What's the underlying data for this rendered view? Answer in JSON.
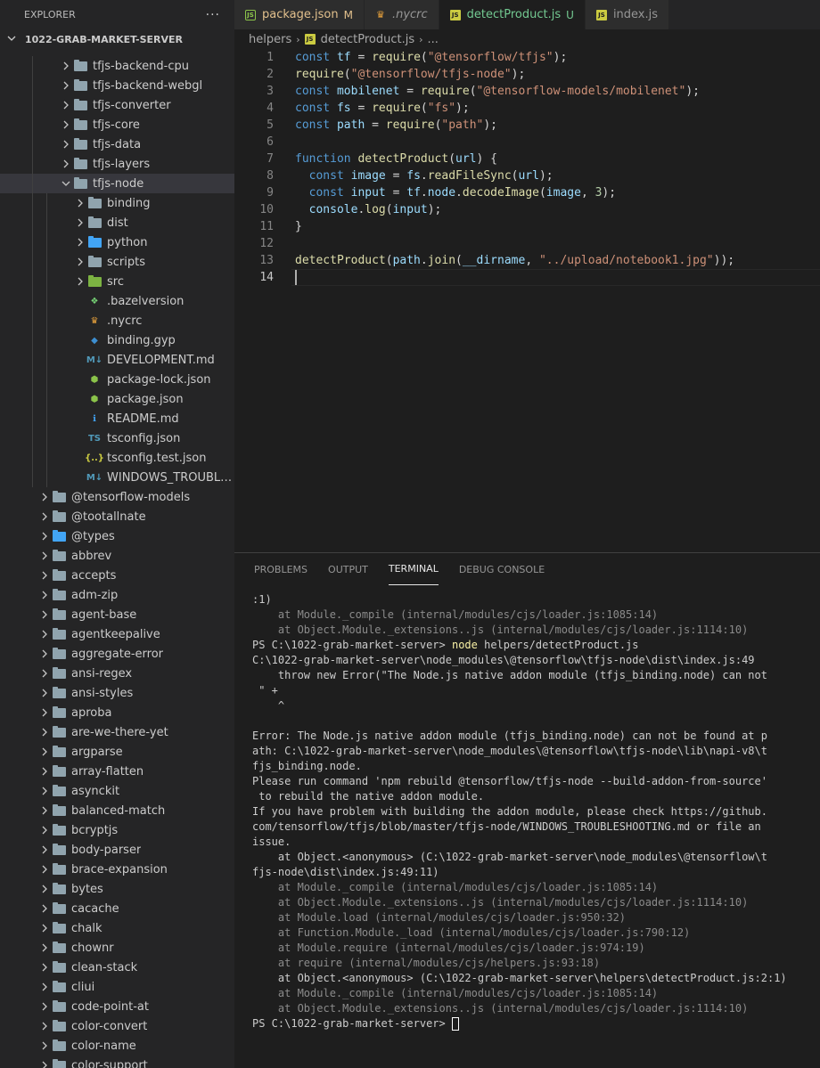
{
  "sidebar": {
    "title": "EXPLORER",
    "more_label": "···",
    "project": "1022-GRAB-MARKET-SERVER",
    "items": [
      {
        "label": "tfjs-backend-cpu",
        "kind": "folder",
        "expanded": false,
        "depth": 2,
        "color": "gray",
        "icon": "folder-icon"
      },
      {
        "label": "tfjs-backend-webgl",
        "kind": "folder",
        "expanded": false,
        "depth": 2,
        "color": "gray",
        "icon": "folder-icon"
      },
      {
        "label": "tfjs-converter",
        "kind": "folder",
        "expanded": false,
        "depth": 2,
        "color": "gray",
        "icon": "folder-icon"
      },
      {
        "label": "tfjs-core",
        "kind": "folder",
        "expanded": false,
        "depth": 2,
        "color": "gray",
        "icon": "folder-icon"
      },
      {
        "label": "tfjs-data",
        "kind": "folder",
        "expanded": false,
        "depth": 2,
        "color": "gray",
        "icon": "folder-icon"
      },
      {
        "label": "tfjs-layers",
        "kind": "folder",
        "expanded": false,
        "depth": 2,
        "color": "gray",
        "icon": "folder-icon"
      },
      {
        "label": "tfjs-node",
        "kind": "folder",
        "expanded": true,
        "depth": 2,
        "color": "gray",
        "icon": "folder-open-icon",
        "selected": true
      },
      {
        "label": "binding",
        "kind": "folder",
        "expanded": false,
        "depth": 3,
        "color": "gray",
        "icon": "folder-icon"
      },
      {
        "label": "dist",
        "kind": "folder",
        "expanded": false,
        "depth": 3,
        "color": "gray",
        "icon": "folder-icon"
      },
      {
        "label": "python",
        "kind": "folder",
        "expanded": false,
        "depth": 3,
        "color": "blue",
        "icon": "python-folder-icon"
      },
      {
        "label": "scripts",
        "kind": "folder",
        "expanded": false,
        "depth": 3,
        "color": "gray",
        "icon": "scripts-folder-icon"
      },
      {
        "label": "src",
        "kind": "folder",
        "expanded": false,
        "depth": 3,
        "color": "green",
        "icon": "src-folder-icon"
      },
      {
        "label": ".bazelversion",
        "kind": "file",
        "depth": 3,
        "icon": "bazel-icon",
        "glyph": "❖",
        "gcolor": "#76d275"
      },
      {
        "label": ".nycrc",
        "kind": "file",
        "depth": 3,
        "icon": "nyc-icon",
        "glyph": "♛",
        "gcolor": "#e8a23c"
      },
      {
        "label": "binding.gyp",
        "kind": "file",
        "depth": 3,
        "icon": "python-icon",
        "glyph": "◆",
        "gcolor": "#3d8fd1"
      },
      {
        "label": "DEVELOPMENT.md",
        "kind": "file",
        "depth": 3,
        "icon": "markdown-icon",
        "glyph": "M↓",
        "gcolor": "#519aba"
      },
      {
        "label": "package-lock.json",
        "kind": "file",
        "depth": 3,
        "icon": "nodejs-icon",
        "glyph": "⬢",
        "gcolor": "#8bc34a"
      },
      {
        "label": "package.json",
        "kind": "file",
        "depth": 3,
        "icon": "nodejs-icon",
        "glyph": "⬢",
        "gcolor": "#8bc34a"
      },
      {
        "label": "README.md",
        "kind": "file",
        "depth": 3,
        "icon": "info-icon",
        "glyph": "ℹ",
        "gcolor": "#42a5f5"
      },
      {
        "label": "tsconfig.json",
        "kind": "file",
        "depth": 3,
        "icon": "tsconfig-icon",
        "glyph": "TS",
        "gcolor": "#519aba"
      },
      {
        "label": "tsconfig.test.json",
        "kind": "file",
        "depth": 3,
        "icon": "json-icon",
        "glyph": "{..}",
        "gcolor": "#cbcb41"
      },
      {
        "label": "WINDOWS_TROUBLESHOOT...",
        "kind": "file",
        "depth": 3,
        "icon": "markdown-icon",
        "glyph": "M↓",
        "gcolor": "#519aba"
      },
      {
        "label": "@tensorflow-models",
        "kind": "folder",
        "expanded": false,
        "depth": 1,
        "color": "gray",
        "icon": "folder-icon"
      },
      {
        "label": "@tootallnate",
        "kind": "folder",
        "expanded": false,
        "depth": 1,
        "color": "gray",
        "icon": "folder-icon"
      },
      {
        "label": "@types",
        "kind": "folder",
        "expanded": false,
        "depth": 1,
        "color": "blue",
        "icon": "types-folder-icon"
      },
      {
        "label": "abbrev",
        "kind": "folder",
        "expanded": false,
        "depth": 1,
        "color": "gray",
        "icon": "folder-icon"
      },
      {
        "label": "accepts",
        "kind": "folder",
        "expanded": false,
        "depth": 1,
        "color": "gray",
        "icon": "folder-icon"
      },
      {
        "label": "adm-zip",
        "kind": "folder",
        "expanded": false,
        "depth": 1,
        "color": "gray",
        "icon": "folder-icon"
      },
      {
        "label": "agent-base",
        "kind": "folder",
        "expanded": false,
        "depth": 1,
        "color": "gray",
        "icon": "folder-icon"
      },
      {
        "label": "agentkeepalive",
        "kind": "folder",
        "expanded": false,
        "depth": 1,
        "color": "gray",
        "icon": "folder-icon"
      },
      {
        "label": "aggregate-error",
        "kind": "folder",
        "expanded": false,
        "depth": 1,
        "color": "gray",
        "icon": "folder-icon"
      },
      {
        "label": "ansi-regex",
        "kind": "folder",
        "expanded": false,
        "depth": 1,
        "color": "gray",
        "icon": "folder-icon"
      },
      {
        "label": "ansi-styles",
        "kind": "folder",
        "expanded": false,
        "depth": 1,
        "color": "gray",
        "icon": "folder-icon"
      },
      {
        "label": "aproba",
        "kind": "folder",
        "expanded": false,
        "depth": 1,
        "color": "gray",
        "icon": "folder-icon"
      },
      {
        "label": "are-we-there-yet",
        "kind": "folder",
        "expanded": false,
        "depth": 1,
        "color": "gray",
        "icon": "folder-icon"
      },
      {
        "label": "argparse",
        "kind": "folder",
        "expanded": false,
        "depth": 1,
        "color": "gray",
        "icon": "folder-icon"
      },
      {
        "label": "array-flatten",
        "kind": "folder",
        "expanded": false,
        "depth": 1,
        "color": "gray",
        "icon": "folder-icon"
      },
      {
        "label": "asynckit",
        "kind": "folder",
        "expanded": false,
        "depth": 1,
        "color": "gray",
        "icon": "folder-icon"
      },
      {
        "label": "balanced-match",
        "kind": "folder",
        "expanded": false,
        "depth": 1,
        "color": "gray",
        "icon": "folder-icon"
      },
      {
        "label": "bcryptjs",
        "kind": "folder",
        "expanded": false,
        "depth": 1,
        "color": "gray",
        "icon": "folder-icon"
      },
      {
        "label": "body-parser",
        "kind": "folder",
        "expanded": false,
        "depth": 1,
        "color": "gray",
        "icon": "folder-icon"
      },
      {
        "label": "brace-expansion",
        "kind": "folder",
        "expanded": false,
        "depth": 1,
        "color": "gray",
        "icon": "folder-icon"
      },
      {
        "label": "bytes",
        "kind": "folder",
        "expanded": false,
        "depth": 1,
        "color": "gray",
        "icon": "folder-icon"
      },
      {
        "label": "cacache",
        "kind": "folder",
        "expanded": false,
        "depth": 1,
        "color": "gray",
        "icon": "folder-icon"
      },
      {
        "label": "chalk",
        "kind": "folder",
        "expanded": false,
        "depth": 1,
        "color": "gray",
        "icon": "folder-icon"
      },
      {
        "label": "chownr",
        "kind": "folder",
        "expanded": false,
        "depth": 1,
        "color": "gray",
        "icon": "folder-icon"
      },
      {
        "label": "clean-stack",
        "kind": "folder",
        "expanded": false,
        "depth": 1,
        "color": "gray",
        "icon": "folder-icon"
      },
      {
        "label": "cliui",
        "kind": "folder",
        "expanded": false,
        "depth": 1,
        "color": "gray",
        "icon": "folder-icon"
      },
      {
        "label": "code-point-at",
        "kind": "folder",
        "expanded": false,
        "depth": 1,
        "color": "gray",
        "icon": "folder-icon"
      },
      {
        "label": "color-convert",
        "kind": "folder",
        "expanded": false,
        "depth": 1,
        "color": "gray",
        "icon": "folder-icon"
      },
      {
        "label": "color-name",
        "kind": "folder",
        "expanded": false,
        "depth": 1,
        "color": "gray",
        "icon": "folder-icon"
      },
      {
        "label": "color-support",
        "kind": "folder",
        "expanded": false,
        "depth": 1,
        "color": "gray",
        "icon": "folder-icon"
      }
    ]
  },
  "tabs": [
    {
      "label": "package.json",
      "modifier": "M",
      "icon": "nodejs-icon",
      "active": false,
      "italic": false,
      "modcolor": "#e2c08d"
    },
    {
      "label": ".nycrc",
      "modifier": "",
      "icon": "nyc-icon",
      "active": false,
      "italic": true,
      "modcolor": ""
    },
    {
      "label": "detectProduct.js",
      "modifier": "U",
      "icon": "js-icon",
      "active": true,
      "italic": false,
      "modcolor": "#73c991"
    },
    {
      "label": "index.js",
      "modifier": "",
      "icon": "js-icon",
      "active": false,
      "italic": false,
      "modcolor": ""
    }
  ],
  "breadcrumb": {
    "folder": "helpers",
    "file": "detectProduct.js",
    "more": "..."
  },
  "code": {
    "lines": [
      [
        [
          "kw",
          "const "
        ],
        [
          "var",
          "tf"
        ],
        [
          "plain",
          " = "
        ],
        [
          "fn",
          "require"
        ],
        [
          "plain",
          "("
        ],
        [
          "str",
          "\"@tensorflow/tfjs\""
        ],
        [
          "plain",
          ");"
        ]
      ],
      [
        [
          "fn",
          "require"
        ],
        [
          "plain",
          "("
        ],
        [
          "str",
          "\"@tensorflow/tfjs-node\""
        ],
        [
          "plain",
          ");"
        ]
      ],
      [
        [
          "kw",
          "const "
        ],
        [
          "var",
          "mobilenet"
        ],
        [
          "plain",
          " = "
        ],
        [
          "fn",
          "require"
        ],
        [
          "plain",
          "("
        ],
        [
          "str",
          "\"@tensorflow-models/mobilenet\""
        ],
        [
          "plain",
          ");"
        ]
      ],
      [
        [
          "kw",
          "const "
        ],
        [
          "var",
          "fs"
        ],
        [
          "plain",
          " = "
        ],
        [
          "fn",
          "require"
        ],
        [
          "plain",
          "("
        ],
        [
          "str",
          "\"fs\""
        ],
        [
          "plain",
          ");"
        ]
      ],
      [
        [
          "kw",
          "const "
        ],
        [
          "var",
          "path"
        ],
        [
          "plain",
          " = "
        ],
        [
          "fn",
          "require"
        ],
        [
          "plain",
          "("
        ],
        [
          "str",
          "\"path\""
        ],
        [
          "plain",
          ");"
        ]
      ],
      [],
      [
        [
          "kw",
          "function "
        ],
        [
          "fn",
          "detectProduct"
        ],
        [
          "plain",
          "("
        ],
        [
          "var",
          "url"
        ],
        [
          "plain",
          ") {"
        ]
      ],
      [
        [
          "plain",
          "  "
        ],
        [
          "kw",
          "const "
        ],
        [
          "var",
          "image"
        ],
        [
          "plain",
          " = "
        ],
        [
          "var",
          "fs"
        ],
        [
          "plain",
          "."
        ],
        [
          "fn",
          "readFileSync"
        ],
        [
          "plain",
          "("
        ],
        [
          "var",
          "url"
        ],
        [
          "plain",
          ");"
        ]
      ],
      [
        [
          "plain",
          "  "
        ],
        [
          "kw",
          "const "
        ],
        [
          "var",
          "input"
        ],
        [
          "plain",
          " = "
        ],
        [
          "var",
          "tf"
        ],
        [
          "plain",
          "."
        ],
        [
          "var",
          "node"
        ],
        [
          "plain",
          "."
        ],
        [
          "fn",
          "decodeImage"
        ],
        [
          "plain",
          "("
        ],
        [
          "var",
          "image"
        ],
        [
          "plain",
          ", "
        ],
        [
          "num",
          "3"
        ],
        [
          "plain",
          ");"
        ]
      ],
      [
        [
          "plain",
          "  "
        ],
        [
          "var",
          "console"
        ],
        [
          "plain",
          "."
        ],
        [
          "fn",
          "log"
        ],
        [
          "plain",
          "("
        ],
        [
          "var",
          "input"
        ],
        [
          "plain",
          ");"
        ]
      ],
      [
        [
          "plain",
          "}"
        ]
      ],
      [],
      [
        [
          "fn",
          "detectProduct"
        ],
        [
          "plain",
          "("
        ],
        [
          "var",
          "path"
        ],
        [
          "plain",
          "."
        ],
        [
          "fn",
          "join"
        ],
        [
          "plain",
          "("
        ],
        [
          "var",
          "__dirname"
        ],
        [
          "plain",
          ", "
        ],
        [
          "str",
          "\"../upload/notebook1.jpg\""
        ],
        [
          "plain",
          "));"
        ]
      ],
      []
    ],
    "current_line": 14
  },
  "panel": {
    "tabs": [
      "PROBLEMS",
      "OUTPUT",
      "TERMINAL",
      "DEBUG CONSOLE"
    ],
    "active_tab": "TERMINAL"
  },
  "terminal": {
    "lines": [
      {
        "c": "norm",
        "t": ":1)"
      },
      {
        "c": "dim",
        "t": "    at Module._compile (internal/modules/cjs/loader.js:1085:14)"
      },
      {
        "c": "dim",
        "t": "    at Object.Module._extensions..js (internal/modules/cjs/loader.js:1114:10)"
      },
      {
        "c": "prompt",
        "t": "PS C:\\1022-grab-market-server> ",
        "cmd": "node",
        "rest": " helpers/detectProduct.js"
      },
      {
        "c": "norm",
        "t": "C:\\1022-grab-market-server\\node_modules\\@tensorflow\\tfjs-node\\dist\\index.js:49"
      },
      {
        "c": "norm",
        "t": "    throw new Error(\"The Node.js native addon module (tfjs_binding.node) can not"
      },
      {
        "c": "norm",
        "t": " \" +"
      },
      {
        "c": "norm",
        "t": "    ^"
      },
      {
        "c": "norm",
        "t": ""
      },
      {
        "c": "norm",
        "t": "Error: The Node.js native addon module (tfjs_binding.node) can not be found at p"
      },
      {
        "c": "norm",
        "t": "ath: C:\\1022-grab-market-server\\node_modules\\@tensorflow\\tfjs-node\\lib\\napi-v8\\t"
      },
      {
        "c": "norm",
        "t": "fjs_binding.node."
      },
      {
        "c": "norm",
        "t": "Please run command 'npm rebuild @tensorflow/tfjs-node --build-addon-from-source'"
      },
      {
        "c": "norm",
        "t": " to rebuild the native addon module."
      },
      {
        "c": "norm",
        "t": "If you have problem with building the addon module, please check https://github."
      },
      {
        "c": "norm",
        "t": "com/tensorflow/tfjs/blob/master/tfjs-node/WINDOWS_TROUBLESHOOTING.md or file an"
      },
      {
        "c": "norm",
        "t": "issue."
      },
      {
        "c": "norm",
        "t": "    at Object.<anonymous> (C:\\1022-grab-market-server\\node_modules\\@tensorflow\\t"
      },
      {
        "c": "norm",
        "t": "fjs-node\\dist\\index.js:49:11)"
      },
      {
        "c": "dim",
        "t": "    at Module._compile (internal/modules/cjs/loader.js:1085:14)"
      },
      {
        "c": "dim",
        "t": "    at Object.Module._extensions..js (internal/modules/cjs/loader.js:1114:10)"
      },
      {
        "c": "dim",
        "t": "    at Module.load (internal/modules/cjs/loader.js:950:32)"
      },
      {
        "c": "dim",
        "t": "    at Function.Module._load (internal/modules/cjs/loader.js:790:12)"
      },
      {
        "c": "dim",
        "t": "    at Module.require (internal/modules/cjs/loader.js:974:19)"
      },
      {
        "c": "dim",
        "t": "    at require (internal/modules/cjs/helpers.js:93:18)"
      },
      {
        "c": "norm",
        "t": "    at Object.<anonymous> (C:\\1022-grab-market-server\\helpers\\detectProduct.js:2:1)"
      },
      {
        "c": "dim",
        "t": "    at Module._compile (internal/modules/cjs/loader.js:1085:14)"
      },
      {
        "c": "dim",
        "t": "    at Object.Module._extensions..js (internal/modules/cjs/loader.js:1114:10)"
      },
      {
        "c": "prompt_end",
        "t": "PS C:\\1022-grab-market-server> "
      }
    ]
  }
}
